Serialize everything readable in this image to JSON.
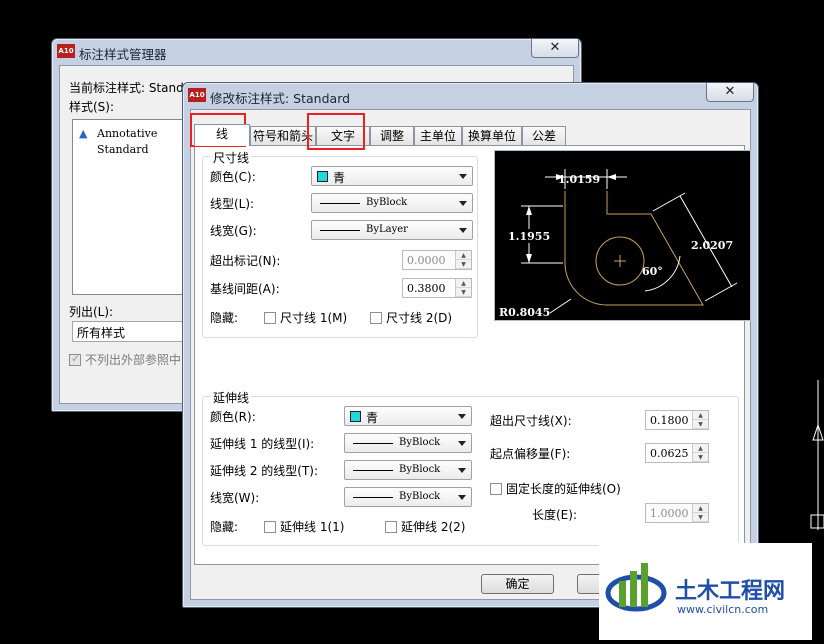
{
  "back_window": {
    "title": "标注样式管理器",
    "close_glyph": "✕",
    "current_style_label": "当前标注样式: Stand",
    "styles_label": "样式(S):",
    "styles": [
      "Annotative",
      "Standard"
    ],
    "list_label": "列出(L):",
    "list_value": "所有样式",
    "xref_checkbox": "不列出外部参照中"
  },
  "front_window": {
    "title": "修改标注样式: Standard",
    "close_glyph": "✕",
    "app_icon_text": "A10",
    "tabs": [
      {
        "label": "线"
      },
      {
        "label": "符号和箭头"
      },
      {
        "label": "文字"
      },
      {
        "label": "调整"
      },
      {
        "label": "主单位"
      },
      {
        "label": "换算单位"
      },
      {
        "label": "公差"
      }
    ],
    "dim_lines": {
      "title": "尺寸线",
      "color_label": "颜色(C):",
      "color_value": "青",
      "linetype_label": "线型(L):",
      "linetype_value": "ByBlock",
      "lineweight_label": "线宽(G):",
      "lineweight_value": "ByLayer",
      "extend_label": "超出标记(N):",
      "extend_value": "0.0000",
      "baseline_label": "基线间距(A):",
      "baseline_value": "0.3800",
      "suppress_label": "隐藏:",
      "suppress_1": "尺寸线 1(M)",
      "suppress_2": "尺寸线 2(D)"
    },
    "ext_lines": {
      "title": "延伸线",
      "color_label": "颜色(R):",
      "color_value": "青",
      "lt1_label": "延伸线 1 的线型(I):",
      "lt1_value": "ByBlock",
      "lt2_label": "延伸线 2 的线型(T):",
      "lt2_value": "ByBlock",
      "lineweight_label": "线宽(W):",
      "lineweight_value": "ByBlock",
      "suppress_label": "隐藏:",
      "suppress_1": "延伸线 1(1)",
      "suppress_2": "延伸线 2(2)",
      "beyond_label": "超出尺寸线(X):",
      "beyond_value": "0.1800",
      "offset_label": "起点偏移量(F):",
      "offset_value": "0.0625",
      "fixed_label": "固定长度的延伸线(O)",
      "length_label": "长度(E):",
      "length_value": "1.0000"
    },
    "preview": {
      "top_dim": "1.0159",
      "left_dim": "1.1955",
      "right_dim": "2.0207",
      "angle": "60°",
      "radius": "R0.8045"
    },
    "ok_button": "确定"
  },
  "watermark": {
    "title": "土木工程网",
    "url": "www.civilcn.com"
  },
  "colors": {
    "cyan_swatch": "#22d8dc",
    "highlight_red": "#e8231f",
    "preview_dim": "#ffffff",
    "preview_geometry": "#c8a060",
    "watermark_blue": "#1f4fa8"
  }
}
